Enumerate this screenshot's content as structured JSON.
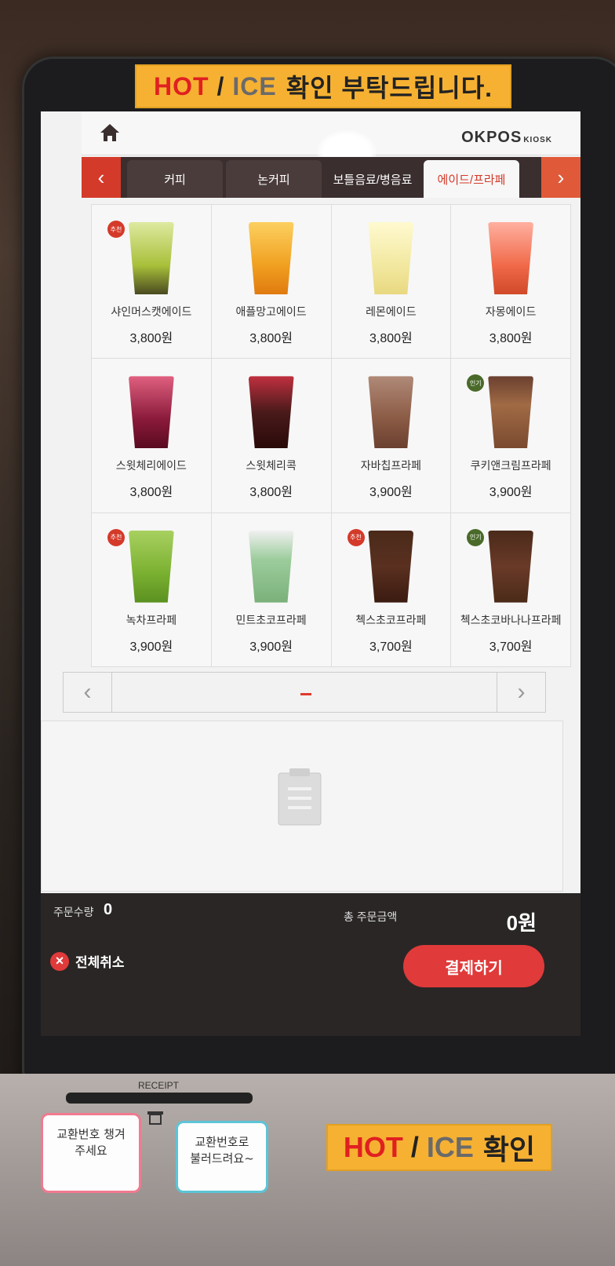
{
  "top_sticker": {
    "hot": "HOT",
    "slash": "/",
    "ice": "ICE",
    "text": "확인 부탁드립니다."
  },
  "header": {
    "brand": "OKPOS",
    "brand_sub": "KIOSK"
  },
  "tabs": [
    {
      "label": "커피"
    },
    {
      "label": "논커피"
    },
    {
      "label": "보틀음료/병음료"
    },
    {
      "label": "에이드/프라페",
      "active": true
    }
  ],
  "products": [
    {
      "name": "샤인머스캣에이드",
      "price": "3,800원",
      "badge": "추천",
      "color": "#a8c03a"
    },
    {
      "name": "애플망고에이드",
      "price": "3,800원",
      "color": "#f0a020"
    },
    {
      "name": "레몬에이드",
      "price": "3,800원",
      "color": "#f2e8a0"
    },
    {
      "name": "자몽에이드",
      "price": "3,800원",
      "color": "#f06a4a"
    },
    {
      "name": "스윗체리에이드",
      "price": "3,800원",
      "color": "#8a1a3a"
    },
    {
      "name": "스윗체리콕",
      "price": "3,800원",
      "color": "#4a1a1a"
    },
    {
      "name": "자바칩프라페",
      "price": "3,900원",
      "color": "#8a5a44"
    },
    {
      "name": "쿠키앤크림프라페",
      "price": "3,900원",
      "badge": "인기",
      "color": "#a06a44"
    },
    {
      "name": "녹차프라페",
      "price": "3,900원",
      "badge": "추천",
      "color": "#7ab030"
    },
    {
      "name": "민트초코프라페",
      "price": "3,900원",
      "color": "#9ccc9c"
    },
    {
      "name": "첵스초코프라페",
      "price": "3,700원",
      "badge": "추천",
      "color": "#5a3020"
    },
    {
      "name": "첵스초코바나나프라페",
      "price": "3,700원",
      "badge": "인기",
      "color": "#6a3a28"
    }
  ],
  "footer": {
    "qty_label": "주문수량",
    "qty_value": "0",
    "total_label": "총 주문금액",
    "total_value": "0원",
    "cancel_label": "전체취소",
    "pay_label": "결제하기"
  },
  "lower": {
    "receipt_label": "RECEIPT",
    "note_left": "교환번호 챙겨주세요",
    "note_right": "교환번호로 불러드려요~",
    "bottom_sticker": {
      "hot": "HOT",
      "slash": "/",
      "ice": "ICE",
      "text": "확인"
    }
  },
  "colors": {
    "accent": "#e03a3a",
    "badge_recommend": "#d43a2a",
    "badge_popular": "#4a6a2a"
  }
}
